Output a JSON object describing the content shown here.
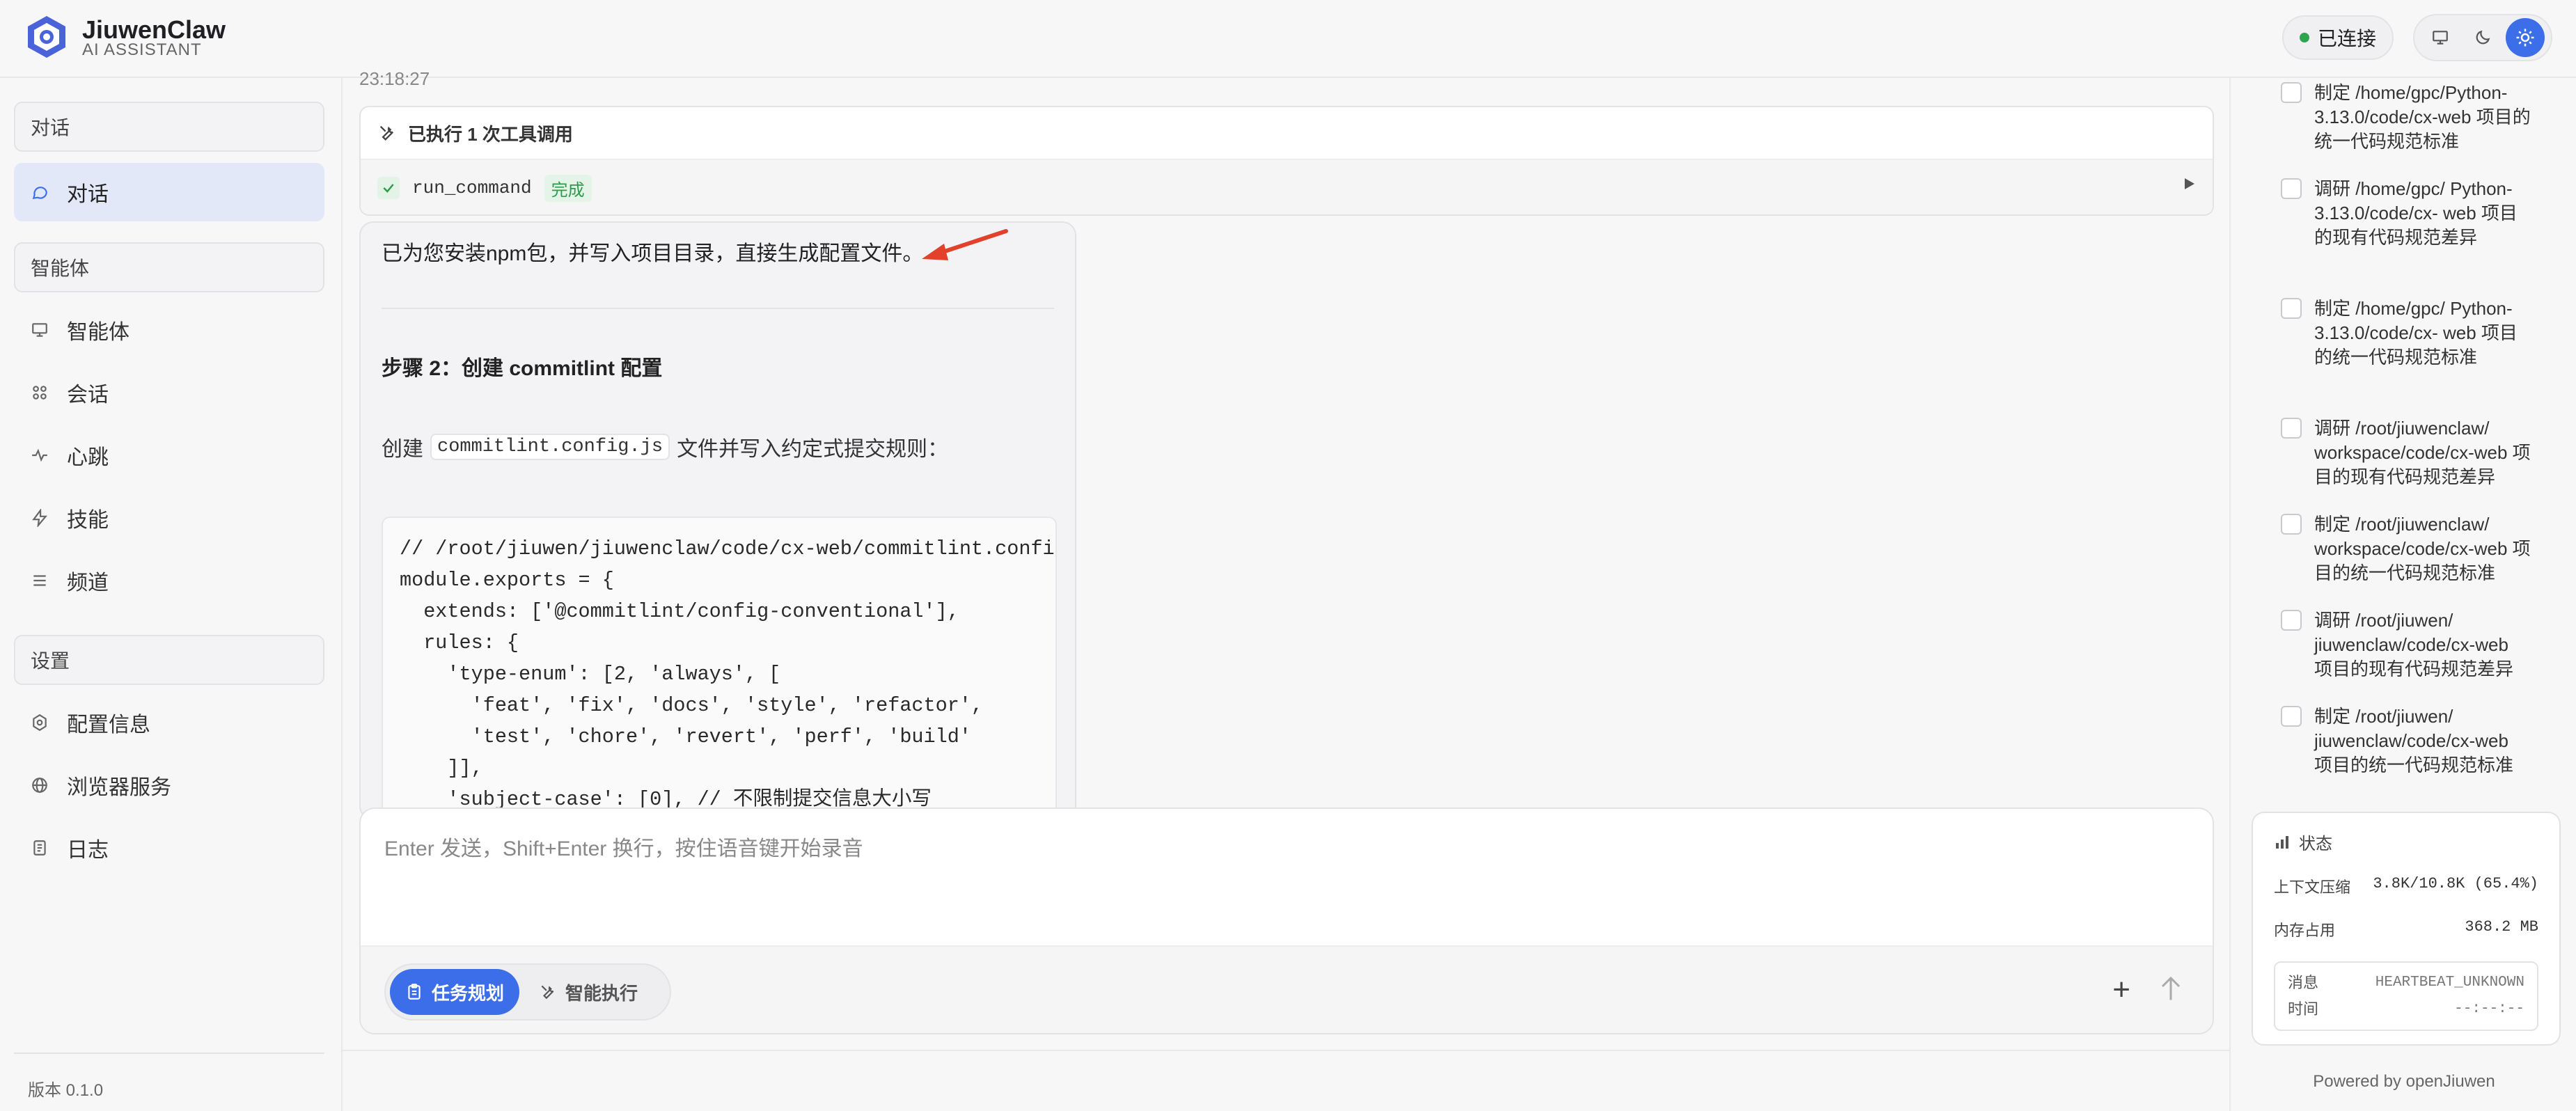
{
  "header": {
    "brand_name": "JiuwenClaw",
    "brand_sub": "AI ASSISTANT",
    "connection_status": "已连接",
    "status_color": "#2ea44f",
    "accent_color": "#3b6ee8",
    "theme_icons": [
      "monitor-icon",
      "moon-icon",
      "sun-icon"
    ]
  },
  "sidebar": {
    "section_chat": "对话",
    "chat_item": "对话",
    "section_agent": "智能体",
    "agent_items": [
      {
        "label": "智能体",
        "icon": "monitor-icon"
      },
      {
        "label": "会话",
        "icon": "nodes-icon"
      },
      {
        "label": "心跳",
        "icon": "pulse-icon"
      },
      {
        "label": "技能",
        "icon": "bolt-icon"
      },
      {
        "label": "频道",
        "icon": "menu-icon"
      }
    ],
    "section_settings": "设置",
    "settings_items": [
      {
        "label": "配置信息",
        "icon": "gear-icon"
      },
      {
        "label": "浏览器服务",
        "icon": "globe-icon"
      },
      {
        "label": "日志",
        "icon": "document-icon"
      }
    ],
    "version": "版本 0.1.0"
  },
  "chat": {
    "timestamp": "23:18:27",
    "tool_header": "已执行 1 次工具调用",
    "tool_name": "run_command",
    "tool_status": "完成",
    "message_line": "已为您安装npm包，并写入项目目录，直接生成配置文件。",
    "step_title": "步骤 2：创建 commitlint 配置",
    "create_prefix": "创建",
    "create_file": "commitlint.config.js",
    "create_suffix": "文件并写入约定式提交规则：",
    "code": "// /root/jiuwen/jiuwenclaw/code/cx-web/commitlint.config.js\nmodule.exports = {\n  extends: ['@commitlint/config-conventional'],\n  rules: {\n    'type-enum': [2, 'always', [\n      'feat', 'fix', 'docs', 'style', 'refactor',\n      'test', 'chore', 'revert', 'perf', 'build'\n    ]],\n    'subject-case': [0], // 不限制提交信息大小写"
  },
  "input": {
    "placeholder": "Enter 发送，Shift+Enter 换行，按住语音键开始录音",
    "mode_plan": "任务规划",
    "mode_exec": "智能执行"
  },
  "tasks": [
    {
      "text": "制定 /home/gpc/Python-3.13.0/code/cx-web 项目的统一代码规范标准",
      "checked": false
    },
    {
      "text": "调研 /home/gpc/ Python-3.13.0/code/cx- web 项目的现有代码规范差异",
      "checked": false
    },
    {
      "text": "制定 /home/gpc/ Python-3.13.0/code/cx- web 项目的统一代码规范标准",
      "checked": false
    },
    {
      "text": "调研 /root/jiuwenclaw/ workspace/code/cx-web 项目的现有代码规范差异",
      "checked": false
    },
    {
      "text": "制定 /root/jiuwenclaw/ workspace/code/cx-web 项目的统一代码规范标准",
      "checked": false
    },
    {
      "text": "调研 /root/jiuwen/ jiuwenclaw/code/cx-web 项目的现有代码规范差异",
      "checked": false
    },
    {
      "text": "制定 /root/jiuwen/ jiuwenclaw/code/cx-web 项目的统一代码规范标准",
      "checked": false
    }
  ],
  "status": {
    "title": "状态",
    "context_label": "上下文压缩",
    "context_value": "3.8K/10.8K (65.4%)",
    "memory_label": "内存占用",
    "memory_value": "368.2 MB",
    "msg_label": "消息",
    "msg_value": "HEARTBEAT_UNKNOWN",
    "time_label": "时间",
    "time_value": "--:--:--"
  },
  "footer": {
    "powered": "Powered by openJiuwen"
  }
}
